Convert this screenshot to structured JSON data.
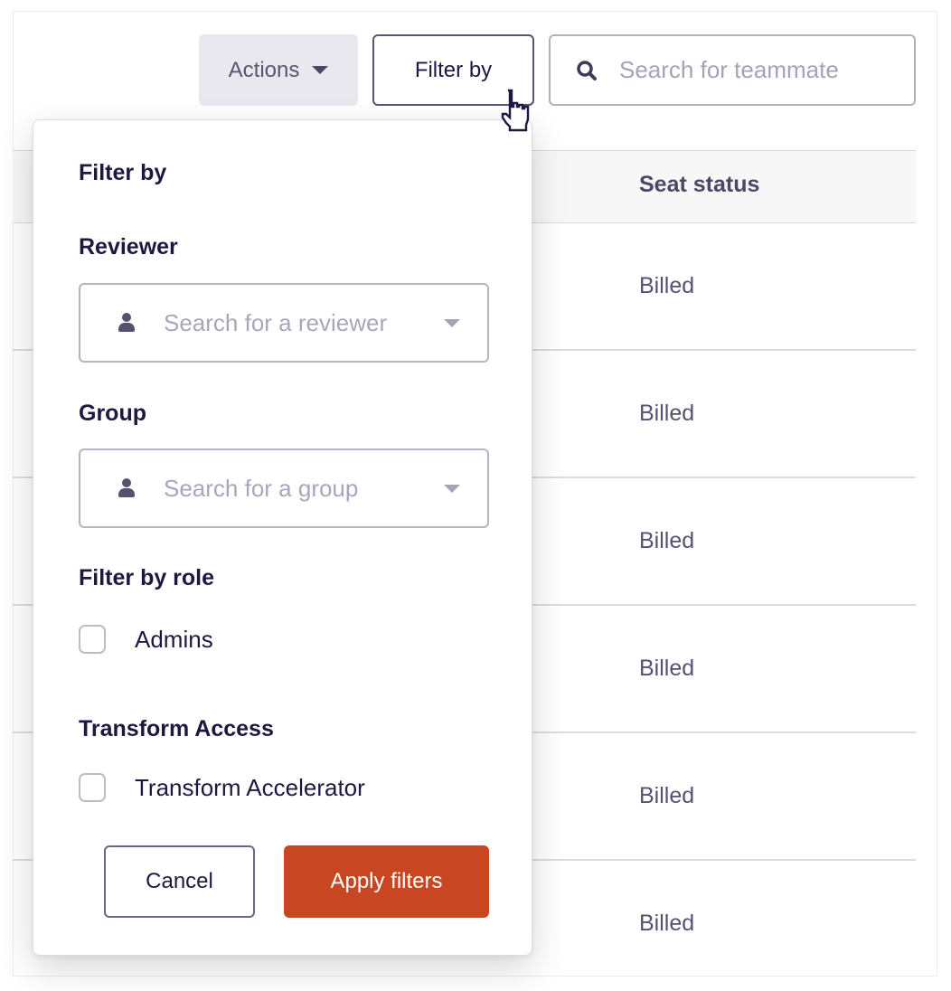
{
  "toolbar": {
    "actions_label": "Actions",
    "filter_label": "Filter by",
    "search": {
      "placeholder": "Search for teammate",
      "value": ""
    }
  },
  "table": {
    "columns": [
      {
        "label": "Seat status"
      }
    ],
    "rows": [
      {
        "seat_status": "Billed"
      },
      {
        "seat_status": "Billed"
      },
      {
        "seat_status": "Billed"
      },
      {
        "seat_status": "Billed"
      },
      {
        "seat_status": "Billed"
      },
      {
        "seat_status": "Billed"
      }
    ]
  },
  "filter_popover": {
    "title": "Filter by",
    "reviewer": {
      "label": "Reviewer",
      "placeholder": "Search for a reviewer",
      "icon": "person-icon"
    },
    "group": {
      "label": "Group",
      "placeholder": "Search for a group",
      "icon": "person-icon"
    },
    "role": {
      "label": "Filter by role",
      "options": [
        {
          "label": "Admins",
          "checked": false
        }
      ]
    },
    "transform": {
      "label": "Transform Access",
      "options": [
        {
          "label": "Transform Accelerator",
          "checked": false
        }
      ]
    },
    "cancel_label": "Cancel",
    "apply_label": "Apply filters"
  },
  "colors": {
    "primary_action": "#c94622",
    "text_primary": "#1d1840",
    "text_secondary": "#565170",
    "placeholder": "#a6a2b6"
  },
  "cursor": {
    "type": "pointer-hand"
  }
}
